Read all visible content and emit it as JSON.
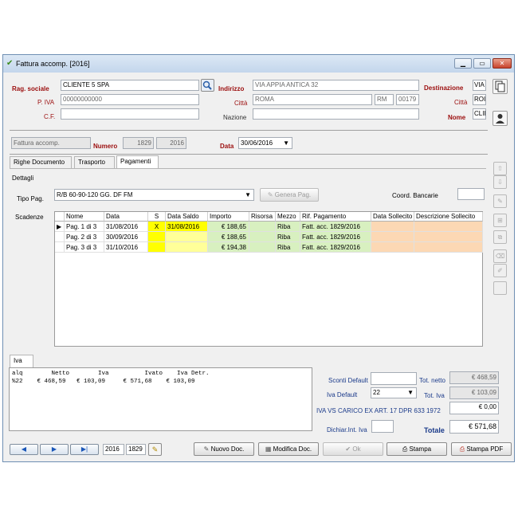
{
  "window": {
    "title": "Fattura accomp. [2016]"
  },
  "header": {
    "rag_sociale_label": "Rag. sociale",
    "rag_sociale_value": "CLIENTE 5 SPA",
    "piva_label": "P. IVA",
    "piva_value": "00000000000",
    "cf_label": "C.F.",
    "cf_value": "",
    "indirizzo_label": "Indirizzo",
    "indirizzo_value": "VIA APPIA ANTICA 32",
    "citta_label": "Città",
    "citta_value": "ROMA",
    "prov_value": "RM",
    "cap_value": "00179",
    "nazione_label": "Nazione",
    "nazione_value": "",
    "destinazione_label": "Destinazione",
    "dest_via_value": "VIA",
    "dest_citta_label": "Città",
    "dest_citta_value": "ROI",
    "dest_nome_label": "Nome",
    "dest_nome_value": "CLII"
  },
  "doc": {
    "tipo_value": "Fattura accomp.",
    "numero_label": "Numero",
    "numero_value": "1829",
    "anno_value": "2016",
    "data_label": "Data",
    "data_value": "30/06/2016"
  },
  "tabs": [
    {
      "label": "Righe Documento"
    },
    {
      "label": "Trasporto"
    },
    {
      "label": "Pagamenti"
    }
  ],
  "pagamenti": {
    "dettagli_label": "Dettagli",
    "tipo_pag_label": "Tipo Pag.",
    "tipo_pag_value": "R/B 60-90-120 GG. DF FM",
    "genera_label": "Genera Pag.",
    "coord_label": "Coord. Bancarie",
    "scadenze_label": "Scadenze"
  },
  "grid": {
    "columns": [
      "Nome",
      "Data",
      "S",
      "Data Saldo",
      "Importo",
      "Risorsa",
      "Mezzo",
      "Rif. Pagamento",
      "Data Sollecito",
      "Descrizione Sollecito"
    ],
    "rows": [
      {
        "nome": "Pag. 1 di 3",
        "data": "31/08/2016",
        "s": "X",
        "data_saldo": "31/08/2016",
        "importo": "€ 188,65",
        "risorsa": "",
        "mezzo": "Riba",
        "rif": "Fatt. acc. 1829/2016",
        "data_soll": "",
        "descr_soll": ""
      },
      {
        "nome": "Pag. 2 di 3",
        "data": "30/09/2016",
        "s": "",
        "data_saldo": "",
        "importo": "€ 188,65",
        "risorsa": "",
        "mezzo": "Riba",
        "rif": "Fatt. acc. 1829/2016",
        "data_soll": "",
        "descr_soll": ""
      },
      {
        "nome": "Pag. 3 di 3",
        "data": "31/10/2016",
        "s": "",
        "data_saldo": "",
        "importo": "€ 194,38",
        "risorsa": "",
        "mezzo": "Riba",
        "rif": "Fatt. acc. 1829/2016",
        "data_soll": "",
        "descr_soll": ""
      }
    ]
  },
  "iva": {
    "tab_label": "Iva",
    "table_header": "alq        Netto        Iva          Ivato    Iva Detr.",
    "table_row": "%22    € 468,59   € 103,09     € 571,68    € 103,09"
  },
  "totals": {
    "sconti_label": "Sconti Default",
    "sconti_value": "",
    "iva_default_label": "Iva Default",
    "iva_default_value": "22",
    "iva_note": "IVA VS CARICO EX ART. 17 DPR 633 1972",
    "iva_note_value": "€ 0,00",
    "dichiar_label": "Dichiar.Int. Iva",
    "dichiar_value": "",
    "tot_netto_label": "Tot. netto",
    "tot_netto_value": "€ 468,59",
    "tot_iva_label": "Tot. Iva",
    "tot_iva_value": "€ 103,09",
    "totale_label": "Totale",
    "totale_value": "€ 571,68"
  },
  "footer": {
    "anno_value": "2016",
    "numero_value": "1829",
    "nuovo_label": "Nuovo Doc.",
    "modifica_label": "Modifica Doc.",
    "ok_label": "Ok",
    "stampa_label": "Stampa",
    "stampa_pdf_label": "Stampa PDF"
  },
  "colors": {
    "label_red": "#9b0d0d",
    "accent_blue": "#1a56b8"
  }
}
